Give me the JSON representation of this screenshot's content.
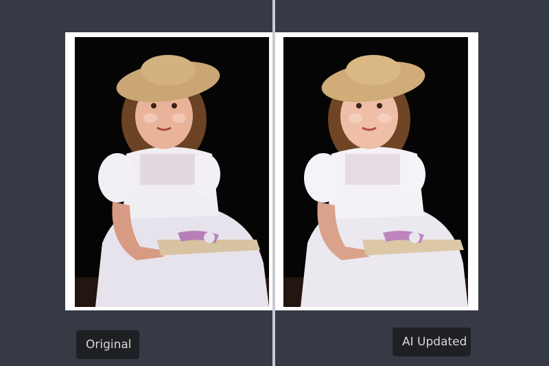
{
  "labels": {
    "original": "Original",
    "ai_updated": "AI Updated"
  },
  "colors": {
    "background": "#353a45",
    "divider": "#c8cbd2",
    "label_bg": "#1f2024",
    "label_text": "#d6d7db",
    "frame": "#ffffff",
    "photo_bg": "#050505"
  },
  "icons": {
    "divider_handle": "vertical-split-handle"
  }
}
